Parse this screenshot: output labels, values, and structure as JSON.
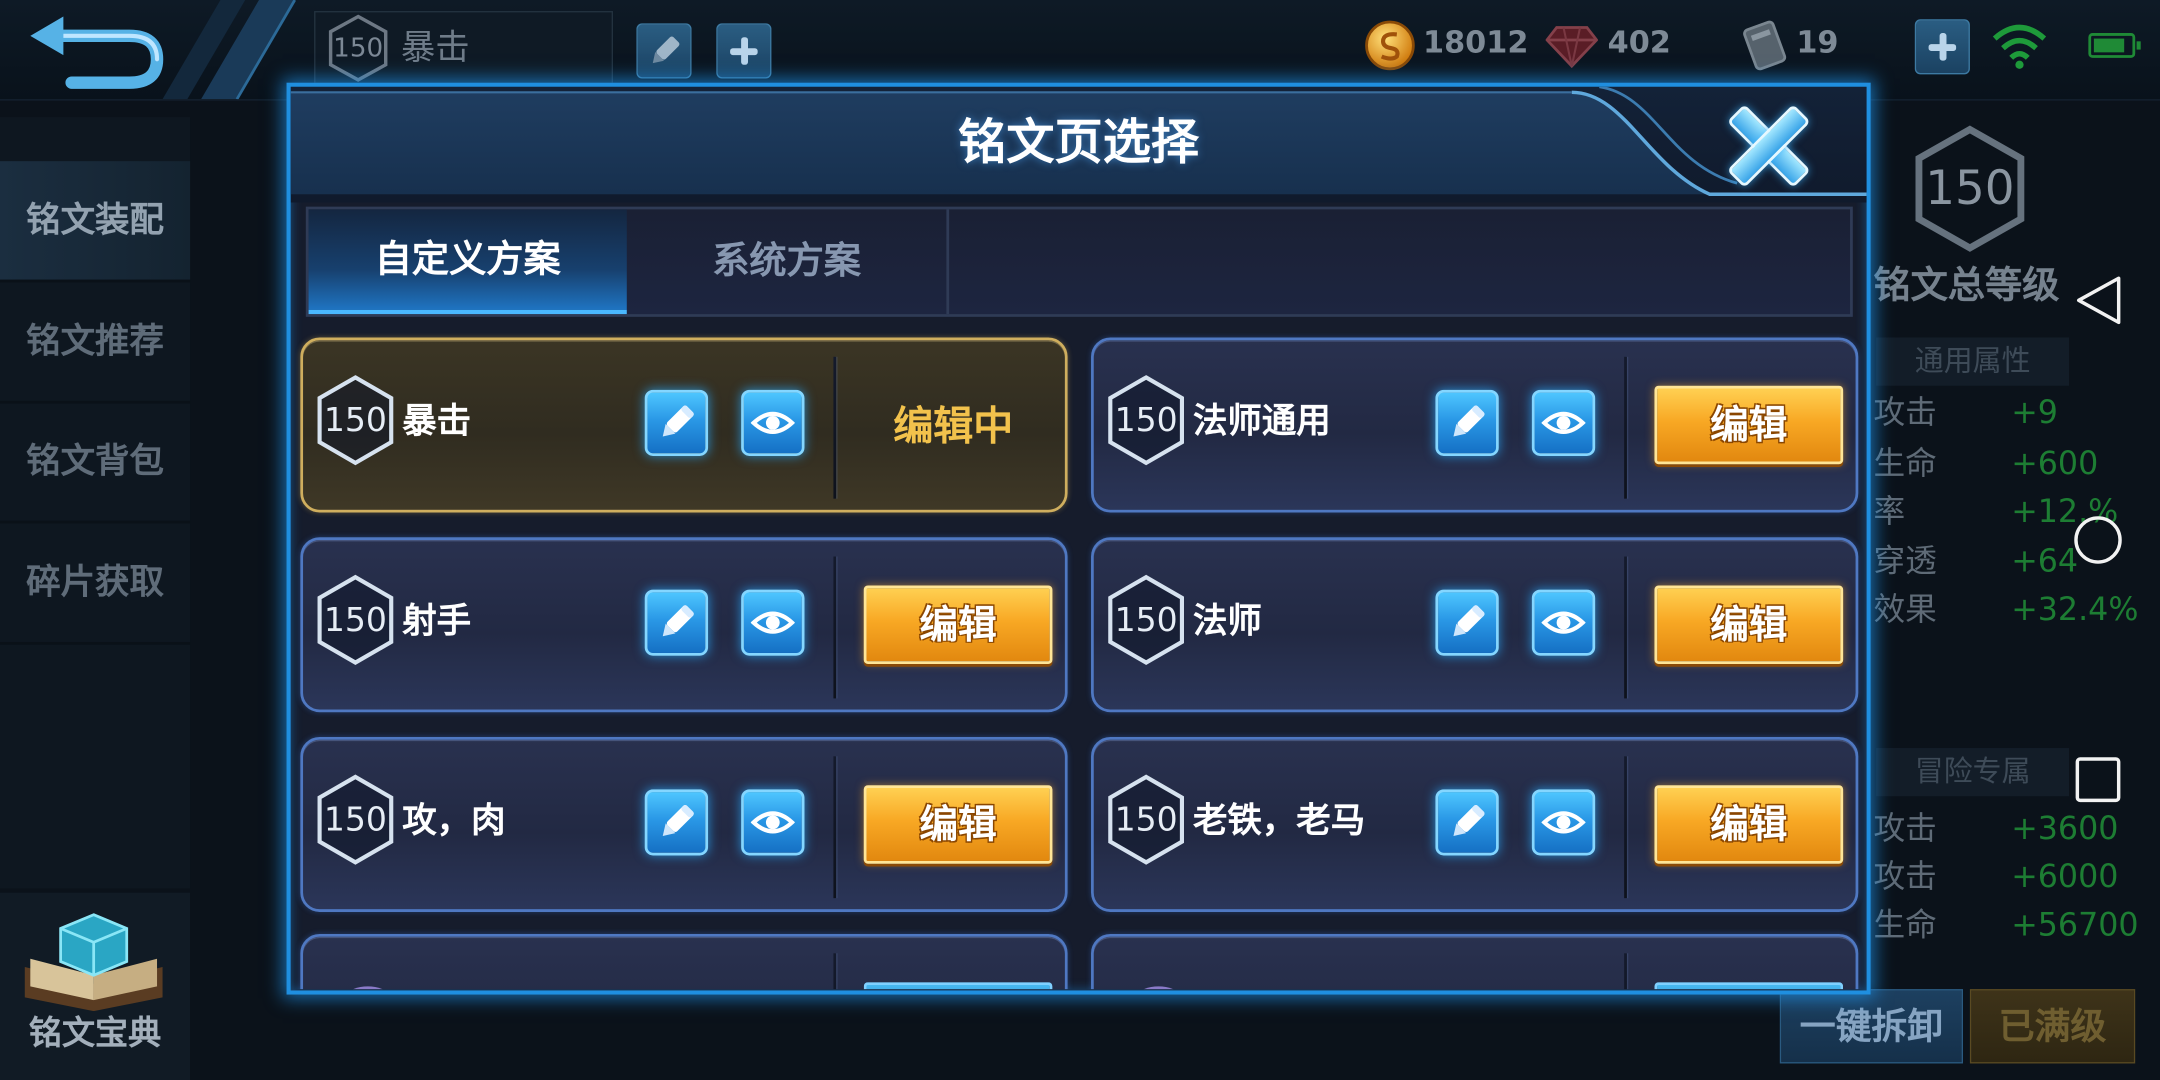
{
  "top_bar": {
    "current_page": {
      "level": "150",
      "name": "暴击"
    },
    "currency": {
      "gold": "18012",
      "diamond": "402",
      "voucher": "19"
    }
  },
  "sidebar": {
    "items": [
      {
        "label": "铭文装配",
        "selected": true
      },
      {
        "label": "铭文推荐"
      },
      {
        "label": "铭文背包"
      },
      {
        "label": "碎片获取"
      }
    ],
    "codex_label": "铭文宝典"
  },
  "summary": {
    "level": "150",
    "level_title": "铭文总等级",
    "general_title": "通用属性",
    "general_stats": [
      {
        "name": "攻击",
        "value": "+9"
      },
      {
        "name": "生命",
        "value": "+600"
      },
      {
        "name": "率",
        "value": "+12.%"
      },
      {
        "name": "穿透",
        "value": "+64"
      },
      {
        "name": "效果",
        "value": "+32.4%"
      }
    ],
    "adventure_title": "冒险专属",
    "adventure_stats": [
      {
        "name": "攻击",
        "value": "+3600"
      },
      {
        "name": "攻击",
        "value": "+6000"
      },
      {
        "name": "生命",
        "value": "+56700"
      }
    ],
    "unload_all_label": "一键拆卸",
    "maxed_label": "已满级"
  },
  "modal": {
    "title": "铭文页选择",
    "tabs": [
      {
        "label": "自定义方案",
        "active": true
      },
      {
        "label": "系统方案",
        "active": false
      }
    ],
    "pages": [
      {
        "level": "150",
        "name": "暴击",
        "status": "编辑中",
        "editing": true
      },
      {
        "level": "150",
        "name": "法师通用",
        "action": "编辑"
      },
      {
        "level": "150",
        "name": "射手",
        "action": "编辑"
      },
      {
        "level": "150",
        "name": "法师",
        "action": "编辑"
      },
      {
        "level": "150",
        "name": "攻，肉",
        "action": "编辑"
      },
      {
        "level": "150",
        "name": "老铁，老马",
        "action": "编辑"
      }
    ]
  },
  "icons": {
    "back": "back-arrow-icon",
    "close": "close-icon",
    "rename": "pencil-icon",
    "preview": "eye-icon",
    "level_badge": "hexagon-icon",
    "gold": "gold-coin-icon",
    "diamond": "diamond-icon",
    "voucher": "voucher-icon",
    "wifi": "wifi-icon",
    "battery": "battery-icon"
  },
  "colors": {
    "accent": "#1f8fe0",
    "edit_button": "#f8a824",
    "editing_text": "#f2c24c",
    "editing_card_border": "#cfae5e",
    "card_border": "#4f78c2",
    "stat_value": "#1d7d33"
  }
}
